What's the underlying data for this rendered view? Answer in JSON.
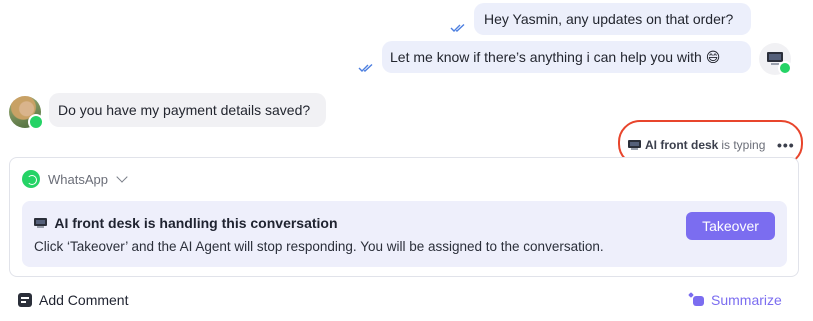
{
  "messages": {
    "outgoing_1": "Hey Yasmin, any updates on that order?",
    "outgoing_2": "Let me know if there’s anything i can help you with 😄",
    "incoming_1": "Do you have my payment details saved?"
  },
  "typing": {
    "name": "AI front desk",
    "status": "is typing",
    "dots": "•••"
  },
  "composer": {
    "channel": "WhatsApp",
    "ai_title": "AI front desk is handling this conversation",
    "ai_description": "Click ‘Takeover’ and the AI Agent will stop responding. You will be assigned to the conversation.",
    "takeover_label": "Takeover"
  },
  "footer": {
    "add_comment": "Add Comment",
    "summarize": "Summarize"
  },
  "colors": {
    "accent": "#7b6df0",
    "whatsapp": "#25d366",
    "highlight_circle": "#e8452c",
    "read_ticks": "#4d7fe0"
  },
  "icons": {
    "read_receipt": "double-check-icon",
    "agent": "monitor-icon",
    "channel": "whatsapp-icon",
    "comment": "comment-icon",
    "summarize": "sparkle-chat-icon"
  }
}
